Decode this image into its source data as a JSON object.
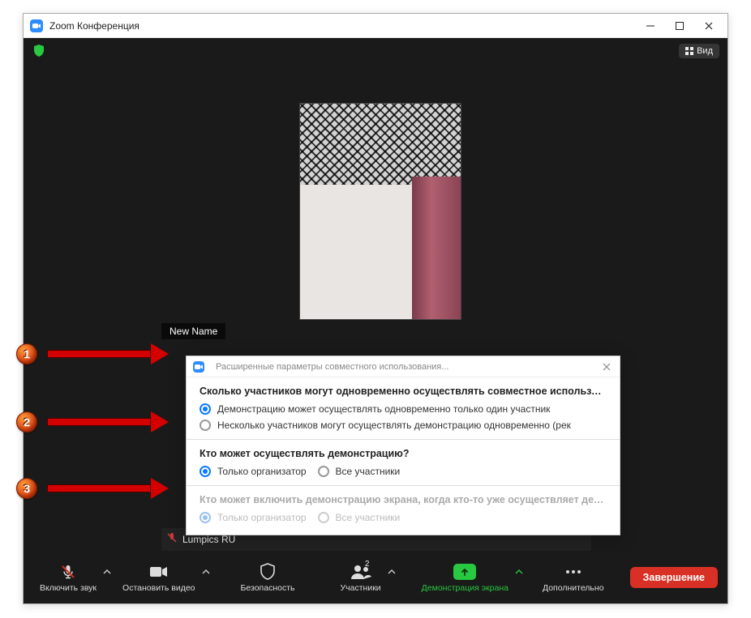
{
  "window": {
    "title": "Zoom Конференция"
  },
  "top": {
    "view_label": "Вид"
  },
  "video": {
    "name_badge": "New Name",
    "secondary_name": "Lumpics RU"
  },
  "dialog": {
    "title": "Расширенные параметры совместного использования...",
    "section1": {
      "title": "Сколько участников могут одновременно осуществлять совместное использование?",
      "opt1": "Демонстрацию может осуществлять одновременно только один участник",
      "opt2": "Несколько участников могут осуществлять демонстрацию одновременно (рек"
    },
    "section2": {
      "title": "Кто может осуществлять демонстрацию?",
      "opt1": "Только организатор",
      "opt2": "Все участники"
    },
    "section3": {
      "title": "Кто может включить демонстрацию экрана, когда кто-то уже осуществляет демонст",
      "opt1": "Только организатор",
      "opt2": "Все участники"
    }
  },
  "toolbar": {
    "mute": "Включить звук",
    "video": "Остановить видео",
    "security": "Безопасность",
    "participants": "Участники",
    "participants_count": "2",
    "share": "Демонстрация экрана",
    "more": "Дополнительно",
    "end": "Завершение"
  },
  "markers": {
    "m1": "1",
    "m2": "2",
    "m3": "3"
  }
}
